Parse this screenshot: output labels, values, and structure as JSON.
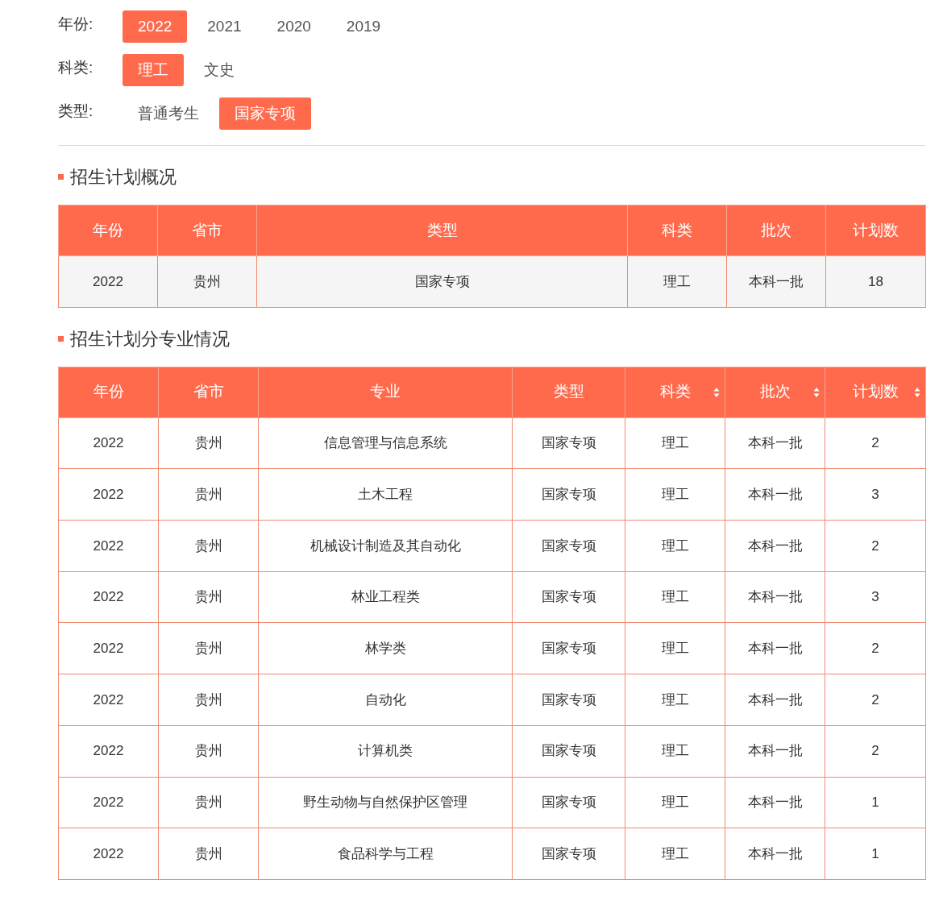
{
  "filters": [
    {
      "label": "年份:",
      "options": [
        {
          "label": "2022",
          "selected": true
        },
        {
          "label": "2021",
          "selected": false
        },
        {
          "label": "2020",
          "selected": false
        },
        {
          "label": "2019",
          "selected": false
        }
      ]
    },
    {
      "label": "科类:",
      "options": [
        {
          "label": "理工",
          "selected": true
        },
        {
          "label": "文史",
          "selected": false
        }
      ]
    },
    {
      "label": "类型:",
      "options": [
        {
          "label": "普通考生",
          "selected": false
        },
        {
          "label": "国家专项",
          "selected": true
        }
      ]
    }
  ],
  "overview": {
    "title": "招生计划概况",
    "columns": [
      {
        "label": "年份",
        "sortable": false
      },
      {
        "label": "省市",
        "sortable": false
      },
      {
        "label": "类型",
        "sortable": false
      },
      {
        "label": "科类",
        "sortable": false
      },
      {
        "label": "批次",
        "sortable": false
      },
      {
        "label": "计划数",
        "sortable": false
      }
    ],
    "rows": [
      [
        "2022",
        "贵州",
        "国家专项",
        "理工",
        "本科一批",
        "18"
      ]
    ]
  },
  "majors": {
    "title": "招生计划分专业情况",
    "columns": [
      {
        "label": "年份",
        "sortable": false
      },
      {
        "label": "省市",
        "sortable": false
      },
      {
        "label": "专业",
        "sortable": false
      },
      {
        "label": "类型",
        "sortable": false
      },
      {
        "label": "科类",
        "sortable": true
      },
      {
        "label": "批次",
        "sortable": true
      },
      {
        "label": "计划数",
        "sortable": true
      }
    ],
    "rows": [
      [
        "2022",
        "贵州",
        "信息管理与信息系统",
        "国家专项",
        "理工",
        "本科一批",
        "2"
      ],
      [
        "2022",
        "贵州",
        "土木工程",
        "国家专项",
        "理工",
        "本科一批",
        "3"
      ],
      [
        "2022",
        "贵州",
        "机械设计制造及其自动化",
        "国家专项",
        "理工",
        "本科一批",
        "2"
      ],
      [
        "2022",
        "贵州",
        "林业工程类",
        "国家专项",
        "理工",
        "本科一批",
        "3"
      ],
      [
        "2022",
        "贵州",
        "林学类",
        "国家专项",
        "理工",
        "本科一批",
        "2"
      ],
      [
        "2022",
        "贵州",
        "自动化",
        "国家专项",
        "理工",
        "本科一批",
        "2"
      ],
      [
        "2022",
        "贵州",
        "计算机类",
        "国家专项",
        "理工",
        "本科一批",
        "2"
      ],
      [
        "2022",
        "贵州",
        "野生动物与自然保护区管理",
        "国家专项",
        "理工",
        "本科一批",
        "1"
      ],
      [
        "2022",
        "贵州",
        "食品科学与工程",
        "国家专项",
        "理工",
        "本科一批",
        "1"
      ]
    ]
  }
}
